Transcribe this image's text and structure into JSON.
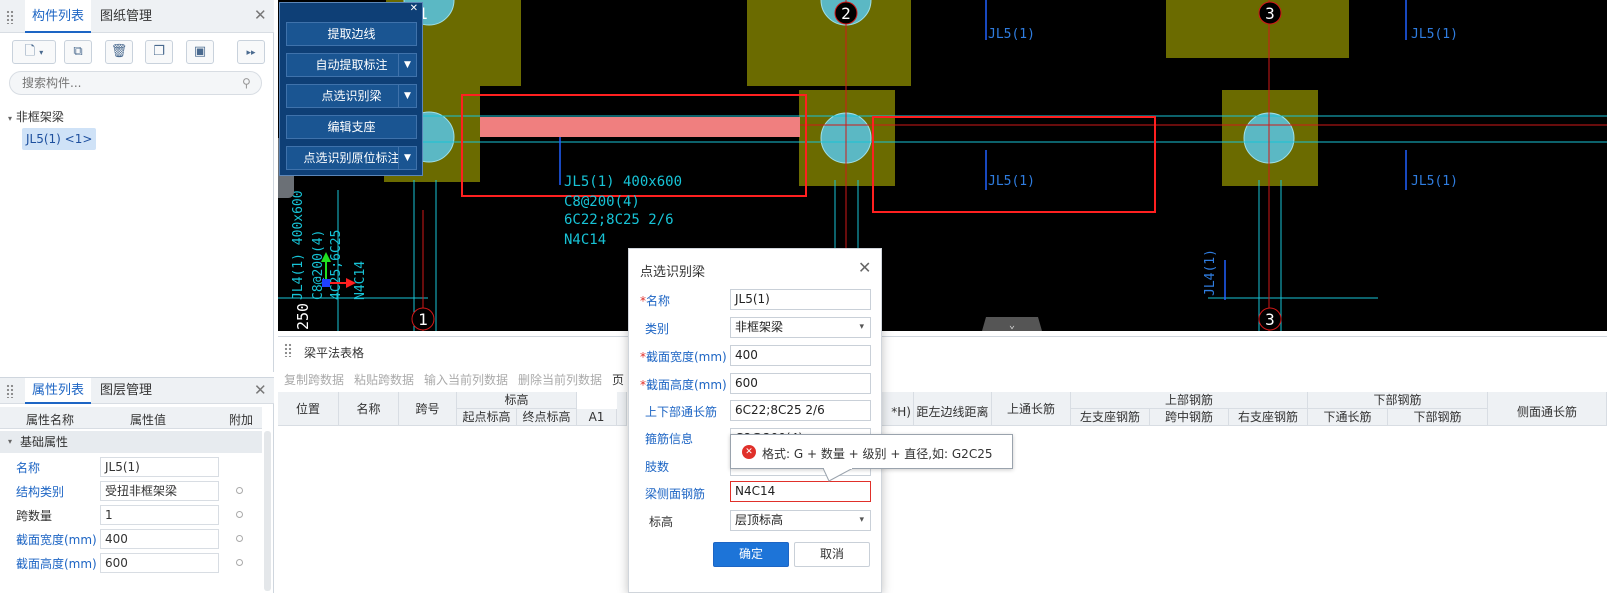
{
  "left_top": {
    "tabs": [
      "构件列表",
      "图纸管理"
    ],
    "search_placeholder": "搜索构件...",
    "tree_root": "非框架梁",
    "tree_item": "JL5(1) <1>"
  },
  "left_bottom": {
    "tabs": [
      "属性列表",
      "图层管理"
    ],
    "columns": [
      "属性名称",
      "属性值",
      "附加"
    ],
    "group": "基础属性",
    "rows": [
      {
        "name": "名称",
        "value": "JL5(1)"
      },
      {
        "name": "结构类别",
        "value": "受扭非框架梁"
      },
      {
        "name": "跨数量",
        "value": "1"
      },
      {
        "name": "截面宽度(mm)",
        "value": "400"
      },
      {
        "name": "截面高度(mm)",
        "value": "600"
      }
    ]
  },
  "tool_panel": {
    "buttons": [
      "提取边线",
      "自动提取标注",
      "点选识别梁",
      "编辑支座",
      "点选识别原位标注"
    ]
  },
  "cad": {
    "axis_labels": [
      "1",
      "2",
      "3",
      "1",
      "3"
    ],
    "beam_labels": [
      "JL5(1)",
      "JL5(1)",
      "JL5(1)",
      "JL5(1)",
      "JL4(1)"
    ],
    "annotation_lines": [
      "JL5(1) 400x600",
      "C8@200(4)",
      "6C22;8C25 2/6",
      "N4C14"
    ],
    "vertical_annot": "JL4(1) 400x600",
    "vertical_annot2": "C8@200(4)",
    "vertical_annot3": "4C25;6C25",
    "vertical_annot4": "N4C14",
    "dim_text": "250"
  },
  "table": {
    "title": "梁平法表格",
    "toolbar": [
      "复制跨数据",
      "粘贴跨数据",
      "输入当前列数据",
      "删除当前列数据",
      "页"
    ],
    "headers": {
      "position": "位置",
      "name": "名称",
      "span": "跨号",
      "elevation": "标高",
      "start_elev": "起点标高",
      "end_elev": "终点标高",
      "a1": "A1",
      "bh": "*H)",
      "left_dist": "距左边线距离",
      "top_long": "上通长筋",
      "top_rebar": "上部钢筋",
      "left_seat": "左支座钢筋",
      "mid": "跨中钢筋",
      "right_seat": "右支座钢筋",
      "bottom_rebar": "下部钢筋",
      "bottom_long": "下通长筋",
      "bottom_sub": "下部钢筋",
      "side_long": "侧面通长筋"
    }
  },
  "dialog": {
    "title": "点选识别梁",
    "fields": [
      {
        "label": "名称",
        "required": true,
        "value": "JL5(1)"
      },
      {
        "label": "类别",
        "required": false,
        "value": "非框架梁"
      },
      {
        "label": "截面宽度(mm)",
        "required": true,
        "value": "400"
      },
      {
        "label": "截面高度(mm)",
        "required": true,
        "value": "600"
      },
      {
        "label": "上下部通长筋",
        "required": false,
        "value": "6C22;8C25 2/6"
      },
      {
        "label": "箍筋信息",
        "required": false,
        "value": "C8@200(4)"
      },
      {
        "label": "肢数",
        "required": false,
        "value": ""
      },
      {
        "label": "梁侧面钢筋",
        "required": false,
        "value": "N4C14"
      },
      {
        "label": "标高",
        "required": false,
        "value": "层顶标高"
      }
    ],
    "ok": "确定",
    "cancel": "取消"
  },
  "tooltip": {
    "text": "格式: G + 数量 + 级别 + 直径,如: G2C25"
  },
  "colors": {
    "accent": "#1d65c4",
    "cad_bg": "#000000",
    "column_fill": "#6b6b00",
    "pile_fill": "#5bb8c4",
    "beam_fill": "#f07f7f",
    "highlight_red": "#ff2020",
    "axis_cyan": "#17c3d6",
    "error": "#e0302a"
  }
}
